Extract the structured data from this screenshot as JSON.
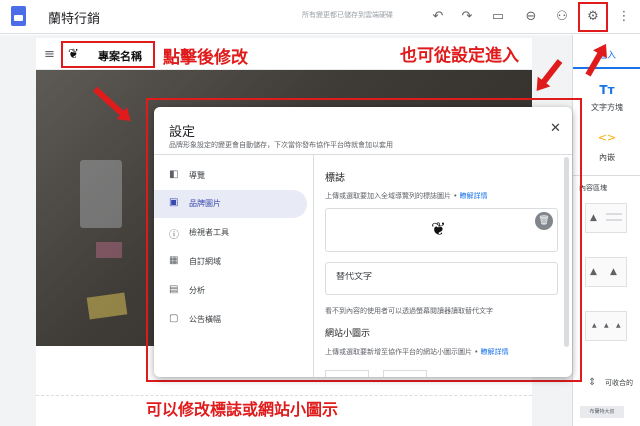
{
  "app": {
    "site_title": "蘭特行銷",
    "save_status": "所有變更都已儲存到雲端硬碟"
  },
  "toolbar": {
    "icons": [
      "undo-icon",
      "redo-icon",
      "preview-icon",
      "link-icon",
      "share-icon",
      "gear-icon",
      "more-vert-icon"
    ]
  },
  "page": {
    "site_name": "專案名稱"
  },
  "sidebar": {
    "tab_insert": "插入",
    "text_box_glyph": "Tт",
    "text_box_label": "文字方塊",
    "embed_glyph": "<>",
    "embed_label": "內嵌",
    "layouts_label": "內容區塊",
    "collapse_label": "可收合的"
  },
  "dialog": {
    "title": "設定",
    "description": "品牌形象設定的變更會自動儲存，下次當你發布協作平台時就會加以套用",
    "close_glyph": "✕",
    "nav": [
      {
        "label": "導覽",
        "icon": "navigation-icon"
      },
      {
        "label": "品牌圖片",
        "icon": "image-icon",
        "active": true
      },
      {
        "label": "檢視者工具",
        "icon": "info-icon"
      },
      {
        "label": "自訂網域",
        "icon": "domain-icon"
      },
      {
        "label": "分析",
        "icon": "analytics-icon"
      },
      {
        "label": "公告橫幅",
        "icon": "announcement-icon"
      }
    ],
    "logo": {
      "title": "標誌",
      "description": "上傳或選取要加入全域導覽列的標誌圖片 •",
      "learn_more": "瞭解詳情",
      "alt_text_placeholder": "替代文字",
      "alt_help": "看不到內容的使用者可以透過螢幕閱讀器讀取替代文字"
    },
    "favicon": {
      "title": "網站小圖示",
      "description": "上傳或選取要新增至協作平台的網站小圖示圖片 •",
      "learn_more": "瞭解詳情"
    }
  },
  "annotations": {
    "click_to_edit": "點擊後修改",
    "from_settings": "也可從設定進入",
    "bottom_note": "可以修改標誌或網站小圖示"
  },
  "watermark": "布蘭特大叔",
  "colors": {
    "annotation_red": "#e01b1b",
    "accent_blue": "#1a73e8",
    "active_nav_bg": "#e8eaf6"
  }
}
